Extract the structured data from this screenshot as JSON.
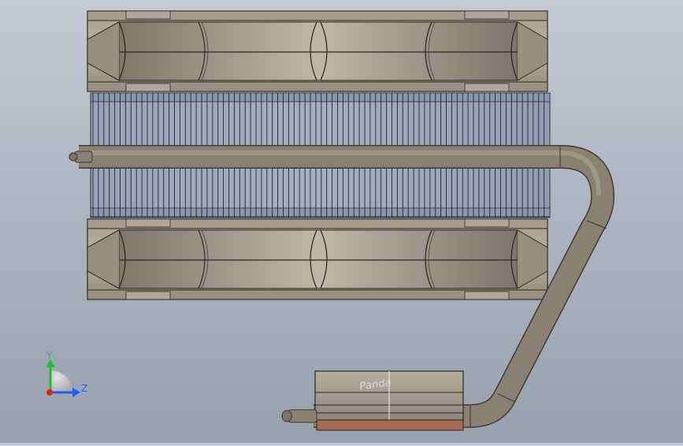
{
  "viewport": {
    "model": "heatsink-assembly",
    "view_orientation": "right"
  },
  "triad": {
    "y_label": "Y",
    "z_label": "Z",
    "y_color": "#1fbf3a",
    "z_color": "#1f5cff",
    "x_color": "#e02020"
  },
  "logo": {
    "text": "Panda"
  },
  "colors": {
    "housing": "#8f8677",
    "housing_light": "#bfb6a6",
    "fin": "#8e98b0",
    "heatpipe": "#7a7266",
    "copper_base": "#a66a55"
  }
}
